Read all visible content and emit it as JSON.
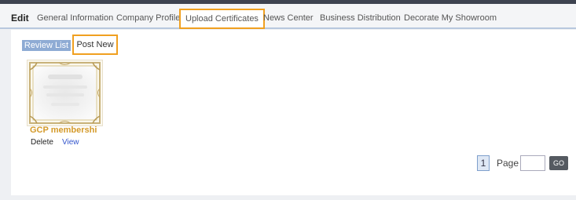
{
  "nav": {
    "edit_label": "Edit",
    "tabs": [
      {
        "label": "General Information"
      },
      {
        "label": "Company Profile"
      },
      {
        "label": "Upload Certificates",
        "active": true
      },
      {
        "label": "News Center"
      },
      {
        "label": "Business Distribution"
      },
      {
        "label": "Decorate My Showroom"
      }
    ]
  },
  "toolbar": {
    "review_list_label": "Review List",
    "post_new_label": "Post New"
  },
  "certificate": {
    "title": "GCP membershi",
    "delete_label": "Delete",
    "view_label": "View",
    "frame_icon": "certificate-frame-icon"
  },
  "pagination": {
    "current_page": "1",
    "page_label": "Page",
    "page_input_value": "",
    "go_label": "GO"
  },
  "colors": {
    "accent_highlight": "#f0a020",
    "review_button": "#8eabd4",
    "cert_title": "#d49a2a",
    "link": "#3355cc"
  }
}
